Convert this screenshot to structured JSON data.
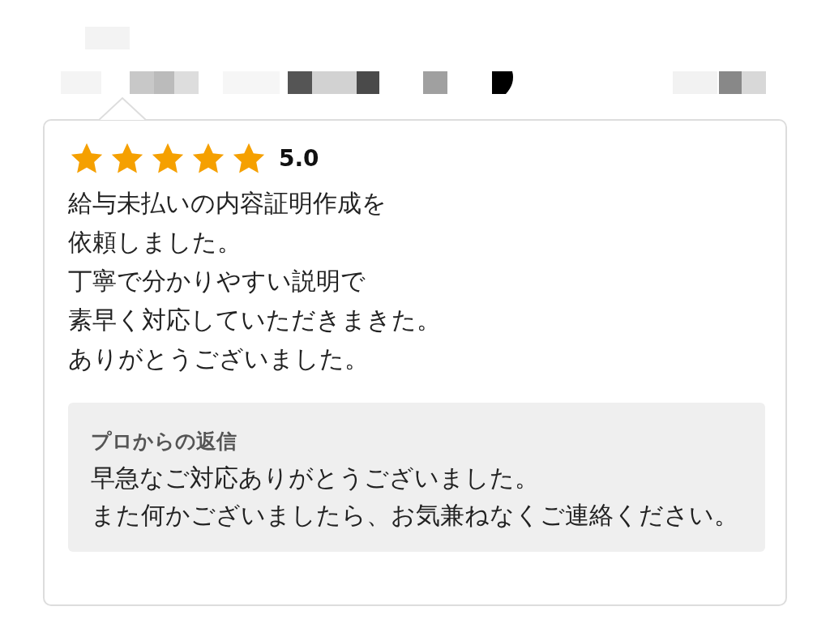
{
  "review": {
    "stars": 5,
    "rating": "5.0",
    "lines": [
      "給与未払いの内容証明作成を",
      "依頼しました。",
      "丁寧で分かりやすい説明で",
      "素早く対応していただきまきた。",
      "ありがとうございました。"
    ]
  },
  "reply": {
    "title": "プロからの返信",
    "lines": [
      "早急なご対応ありがとうございました。",
      "また何かございましたら、お気兼ねなくご連絡ください。"
    ]
  }
}
